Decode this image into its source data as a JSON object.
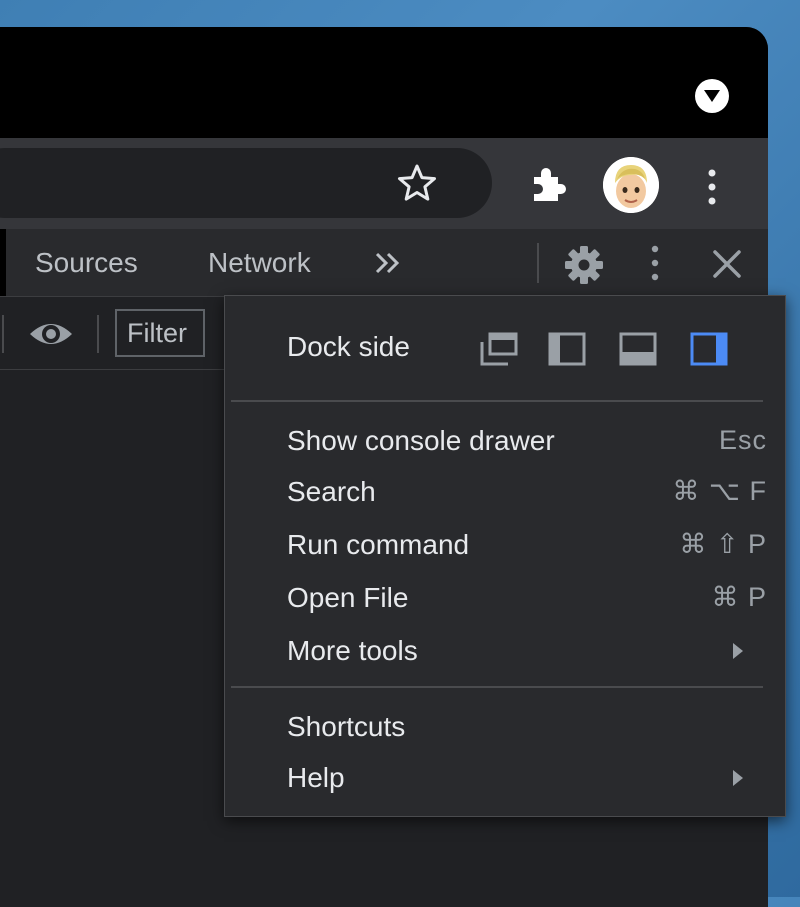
{
  "devtools": {
    "tabs": [
      {
        "label": "Sources"
      },
      {
        "label": "Network"
      }
    ],
    "filter_label": "Filter"
  },
  "menu": {
    "dock_side_label": "Dock side",
    "accent_color": "#4c8bf5",
    "items": [
      {
        "label": "Show console drawer",
        "shortcut": "Esc"
      },
      {
        "label": "Search",
        "shortcut": "⌘ ⌥ F"
      },
      {
        "label": "Run command",
        "shortcut": "⌘ ⇧ P"
      },
      {
        "label": "Open File",
        "shortcut": "⌘ P"
      },
      {
        "label": "More tools",
        "shortcut": ""
      },
      {
        "label": "Shortcuts",
        "shortcut": ""
      },
      {
        "label": "Help",
        "shortcut": ""
      }
    ]
  }
}
